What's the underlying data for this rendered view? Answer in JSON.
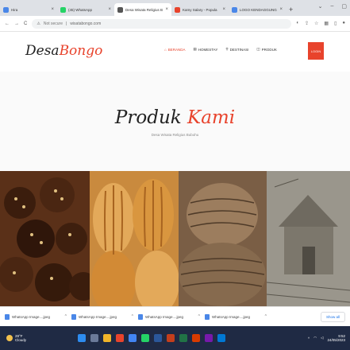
{
  "browser": {
    "tabs": [
      {
        "label": "Hira",
        "color": "#4a87e8",
        "active": false
      },
      {
        "label": "(45) WhatsApp",
        "color": "#25d366",
        "active": false
      },
      {
        "label": "Desa Wisata Religius Bu",
        "color": "#555555",
        "active": true
      },
      {
        "label": "Kamy Salary - Popula",
        "color": "#e8432c",
        "active": false
      },
      {
        "label": "LOGO KENDAGGUNGO",
        "color": "#4a87e8",
        "active": false
      }
    ],
    "new_tab": "+",
    "address": {
      "security": "Not secure",
      "url": "wisatabongo.com"
    }
  },
  "site": {
    "logo": {
      "part1": "Desa",
      "part2": "Bongo"
    },
    "nav": [
      {
        "label": "BERANDA",
        "active": true
      },
      {
        "label": "HOMESTAY",
        "active": false
      },
      {
        "label": "DESTINASI",
        "active": false
      },
      {
        "label": "PRODUK",
        "active": false
      }
    ],
    "login": "LOGIN",
    "title": {
      "part1": "Produk",
      "part2": "Kami"
    },
    "subtitle": "Desa Wisata Religius Bubohu"
  },
  "downloads": {
    "items": [
      "WhatsApp Image....jpeg",
      "WhatsApp Image....jpeg",
      "WhatsApp Image....jpeg",
      "WhatsApp Image....jpeg"
    ],
    "show_all": "Show all"
  },
  "taskbar": {
    "weather_temp": "28°F",
    "weather_desc": "Cloudy",
    "time": "9:52",
    "date": "24/05/2023"
  },
  "colors": {
    "accent": "#e8432c"
  }
}
